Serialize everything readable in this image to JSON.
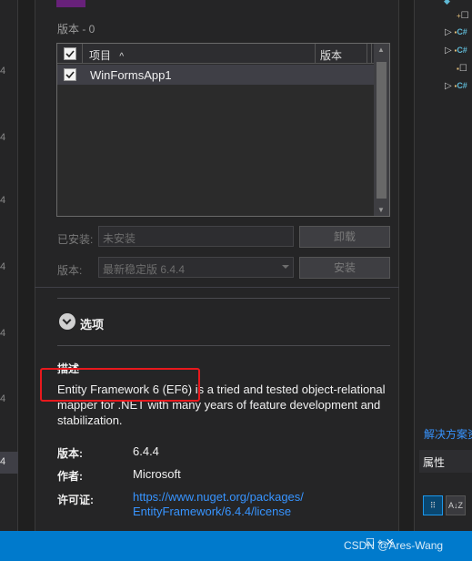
{
  "left_strip": {
    "numbers": [
      "4",
      "4",
      "4",
      "4",
      "4",
      "4",
      "4"
    ],
    "selected_number": "4"
  },
  "versions_section": {
    "title": "版本 - 0"
  },
  "projects_table": {
    "columns": {
      "project": "项目",
      "version": "版本"
    },
    "rows": [
      {
        "name": "WinFormsApp1",
        "version": ""
      }
    ]
  },
  "installed": {
    "label": "已安装:",
    "value": "未安装",
    "uninstall_button": "卸载"
  },
  "version_select": {
    "label": "版本:",
    "value": "最新稳定版 6.4.4",
    "install_button": "安装"
  },
  "options": {
    "label": "选项"
  },
  "description": {
    "title": "描述",
    "text": "Entity Framework 6 (EF6) is a tried and tested object-relational mapper for .NET with many years of feature development and stabilization."
  },
  "meta": {
    "version_label": "版本:",
    "version_value": "6.4.4",
    "author_label": "作者:",
    "author_value": "Microsoft",
    "license_label": "许可证:",
    "license_url_line1": "https://www.nuget.org/packages/",
    "license_url_line2": "EntityFramework/6.4.4/license"
  },
  "right_pane": {
    "tree_items": [
      "C#",
      "C#",
      "C#",
      "C#",
      "C#"
    ],
    "solution_tab": "解决方案资",
    "properties_title": "属性",
    "tool_categorized": "⠿",
    "tool_alpha": "A↓Z"
  },
  "status_bar": {
    "icons": "☐ ⌖ ✕"
  },
  "watermark": "CSDN @Ares-Wang",
  "colors": {
    "accent": "#007acc",
    "highlight": "#e8191d",
    "link": "#3794ff",
    "panel": "#252526"
  }
}
